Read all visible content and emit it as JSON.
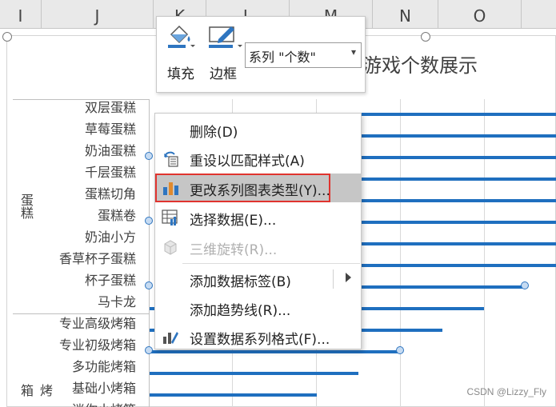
{
  "columns": [
    "I",
    "J",
    "K",
    "L",
    "M",
    "N",
    "O"
  ],
  "chart_title_fragment": "游戏个数展示",
  "categories": [
    "双层蛋糕",
    "草莓蛋糕",
    "奶油蛋糕",
    "千层蛋糕",
    "蛋糕切角",
    "蛋糕卷",
    "奶油小方",
    "香草杯子蛋糕",
    "杯子蛋糕",
    "马卡龙",
    "专业高级烤箱",
    "专业初级烤箱",
    "多功能烤箱",
    "基础小烤箱",
    "迷你小烤箱"
  ],
  "groups": [
    "蛋糕",
    "烤箱"
  ],
  "mini_toolbar": {
    "fill_label": "填充",
    "border_label": "边框",
    "series_selector": "系列 \"个数\""
  },
  "context_menu": {
    "items": [
      {
        "label": "删除(D)",
        "icon": "none-icon",
        "enabled": true
      },
      {
        "label": "重设以匹配样式(A)",
        "icon": "reset-style-icon",
        "enabled": true
      },
      {
        "label": "更改系列图表类型(Y)...",
        "icon": "chart-type-icon",
        "enabled": true,
        "highlighted": true
      },
      {
        "label": "选择数据(E)...",
        "icon": "select-data-icon",
        "enabled": true
      },
      {
        "label": "三维旋转(R)...",
        "icon": "3d-rotation-icon",
        "enabled": false
      },
      {
        "label": "添加数据标签(B)",
        "icon": "none-icon",
        "enabled": true,
        "has_submenu": true
      },
      {
        "label": "添加趋势线(R)...",
        "icon": "none-icon",
        "enabled": true
      },
      {
        "label": "设置数据系列格式(F)...",
        "icon": "format-series-icon",
        "enabled": true
      }
    ]
  },
  "watermark": "CSDN @Lizzy_Fly",
  "colors": {
    "bar": "#1f6fbf",
    "highlight_border": "#e0342f",
    "menu_highlight": "#c6c6c6"
  }
}
